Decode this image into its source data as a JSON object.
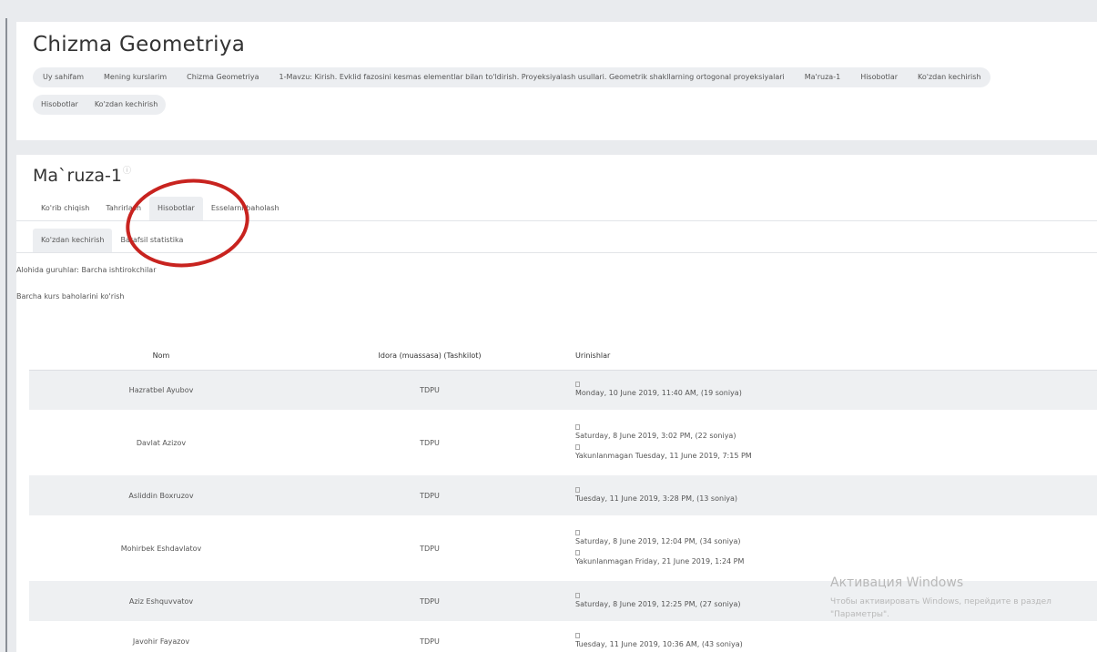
{
  "header": {
    "title": "Chizma Geometriya",
    "breadcrumb": [
      "Uy sahifam",
      "Mening kurslarim",
      "Chizma Geometriya",
      "1-Mavzu: Kirish. Evklid fazosini kesmas elementlar bilan to'ldirish. Proyeksiyalash usullari. Geometrik shakllarning ortogonal proyeksiyalari",
      "Ma'ruza-1",
      "Hisobotlar",
      "Ko'zdan kechirish"
    ],
    "breadcrumb_row2": [
      "Hisobotlar",
      "Ko'zdan kechirish"
    ]
  },
  "module": {
    "title": "Ma`ruza-1",
    "help_icon": "?",
    "tabs": [
      "Ko'rib chiqish",
      "Tahrirlash",
      "Hisobotlar",
      "Esselarni baholash"
    ],
    "active_tab": "Hisobotlar",
    "subtabs": [
      "Ko'zdan kechirish",
      "Batafsil statistika"
    ],
    "active_subtab": "Ko'zdan kechirish",
    "groups_text": "Alohida guruhlar: Barcha ishtirokchilar",
    "view_all_grades": "Barcha kurs baholarini ko'rish"
  },
  "table": {
    "headers": [
      "Nom",
      "Idora (muassasa) (Tashkilot)",
      "Urinishlar"
    ],
    "rows": [
      {
        "name": "Hazratbel Ayubov",
        "org": "TDPU",
        "attempts": [
          "Monday, 10 June 2019, 11:40 AM, (19 soniya)"
        ]
      },
      {
        "name": "Davlat Azizov",
        "org": "TDPU",
        "attempts": [
          "Saturday, 8 June 2019, 3:02 PM, (22 soniya)",
          "Yakunlanmagan Tuesday, 11 June 2019, 7:15 PM"
        ]
      },
      {
        "name": "Asliddin Boxruzov",
        "org": "TDPU",
        "attempts": [
          "Tuesday, 11 June 2019, 3:28 PM, (13 soniya)"
        ]
      },
      {
        "name": "Mohirbek Eshdavlatov",
        "org": "TDPU",
        "attempts": [
          "Saturday, 8 June 2019, 12:04 PM, (34 soniya)",
          "Yakunlanmagan Friday, 21 June 2019, 1:24 PM"
        ]
      },
      {
        "name": "Aziz Eshquvvatov",
        "org": "TDPU",
        "attempts": [
          "Saturday, 8 June 2019, 12:25 PM, (27 soniya)"
        ]
      },
      {
        "name": "Javohir Fayazov",
        "org": "TDPU",
        "attempts": [
          "Tuesday, 11 June 2019, 10:36 AM, (43 soniya)"
        ]
      }
    ]
  },
  "watermark": {
    "title": "Активация Windows",
    "line1": "Чтобы активировать Windows, перейдите в раздел",
    "line2": "\"Параметры\"."
  },
  "colors": {
    "annotation": "#c8231f",
    "row_alt": "#eef0f2",
    "background": "#e9ebee"
  }
}
